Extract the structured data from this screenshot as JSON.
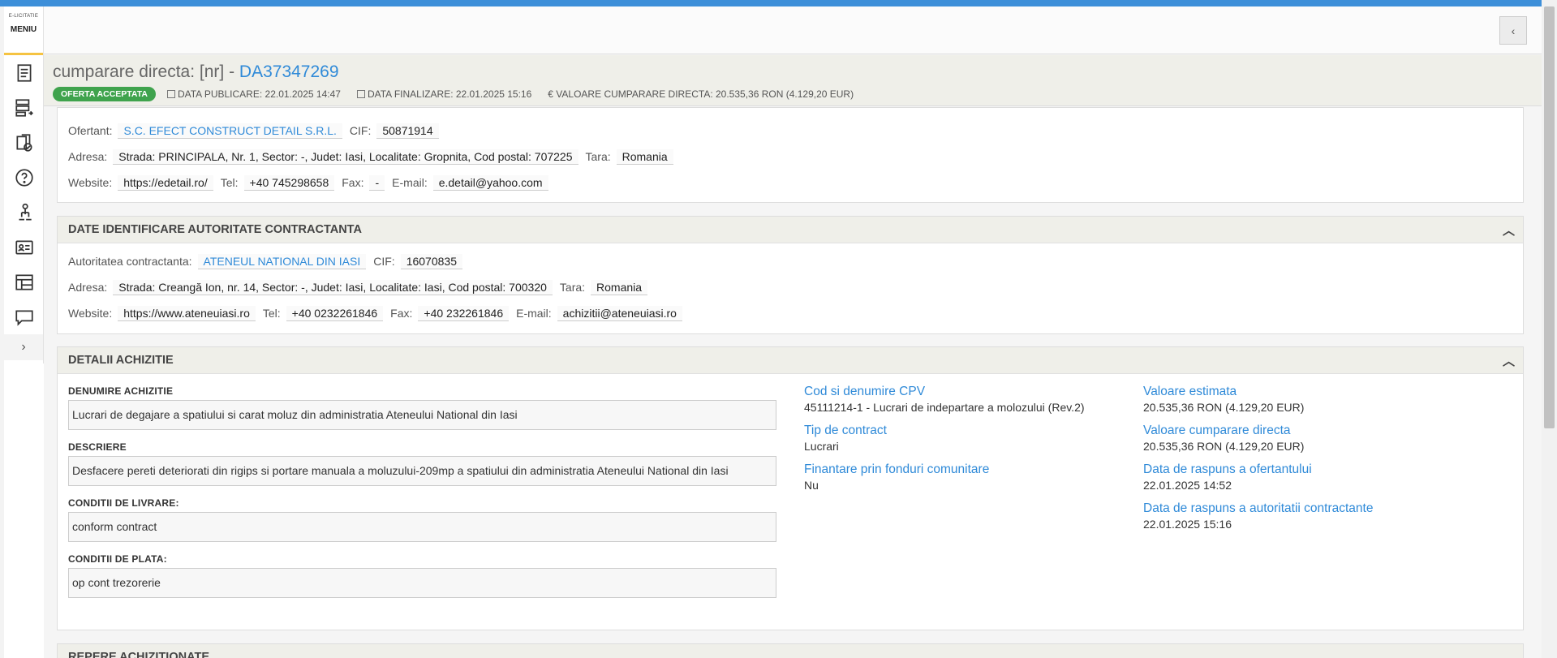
{
  "sidebar": {
    "logo_small": "E-LICITATIE",
    "menu_label": "MENIU",
    "expand_glyph": "›",
    "icons": [
      "document-icon",
      "list-export-icon",
      "clipboard-check-icon",
      "help-circle-icon",
      "user-tree-icon",
      "id-card-icon",
      "layout-icon",
      "chat-bubble-icon"
    ]
  },
  "header": {
    "collapse_glyph": "‹"
  },
  "procedure": {
    "title_prefix": "cumparare directa: [nr] - ",
    "code": "DA37347269",
    "status_badge": "OFERTA ACCEPTATA",
    "publish": "DATA PUBLICARE: 22.01.2025 14:47",
    "finish": "DATA FINALIZARE: 22.01.2025 15:16",
    "value": "€ VALOARE CUMPARARE DIRECTA: 20.535,36  RON (4.129,20  EUR)"
  },
  "ofertant": {
    "label_name": "Ofertant:",
    "name": "S.C. EFECT CONSTRUCT DETAIL S.R.L.",
    "label_cif": "CIF:",
    "cif": "50871914",
    "label_address": "Adresa:",
    "address": "Strada: PRINCIPALA, Nr. 1, Sector: -, Judet: Iasi, Localitate: Gropnita, Cod postal: 707225",
    "label_country": "Tara:",
    "country": "Romania",
    "label_website": "Website:",
    "website": "https://edetail.ro/",
    "label_tel": "Tel:",
    "tel": "+40 745298658",
    "label_fax": "Fax:",
    "fax": "-",
    "label_email": "E-mail:",
    "email": "e.detail@yahoo.com"
  },
  "authority": {
    "heading": "DATE IDENTIFICARE AUTORITATE CONTRACTANTA",
    "label_name": "Autoritatea contractanta:",
    "name": "ATENEUL NATIONAL DIN IASI",
    "label_cif": "CIF:",
    "cif": "16070835",
    "label_address": "Adresa:",
    "address": "Strada: Creangă Ion, nr. 14, Sector: -, Judet: Iasi, Localitate: Iasi, Cod postal: 700320",
    "label_country": "Tara:",
    "country": "Romania",
    "label_website": "Website:",
    "website": "https://www.ateneuiasi.ro",
    "label_tel": "Tel:",
    "tel": "+40 0232261846",
    "label_fax": "Fax:",
    "fax": "+40 232261846",
    "label_email": "E-mail:",
    "email": "achizitii@ateneuiasi.ro"
  },
  "details": {
    "heading": "DETALII ACHIZITIE",
    "name_label": "DENUMIRE ACHIZITIE",
    "name": "Lucrari de degajare a spatiului si carat moluz din administratia Ateneului National din Iasi",
    "desc_label": "DESCRIERE",
    "desc": "Desfacere pereti deteriorati din rigips si portare manuala a moluzului-209mp a spatiului din administratia Ateneului National din Iasi",
    "delivery_label": "CONDITII DE LIVRARE:",
    "delivery": "conform contract",
    "payment_label": "CONDITII DE PLATA:",
    "payment": "op cont trezorerie",
    "cpv_label": "Cod si denumire CPV",
    "cpv": "45111214-1 - Lucrari de indepartare a molozului (Rev.2)",
    "contract_type_label": "Tip de contract",
    "contract_type": "Lucrari",
    "eu_funds_label": "Finantare prin fonduri comunitare",
    "eu_funds": "Nu",
    "est_value_label": "Valoare estimata",
    "est_value": "20.535,36  RON (4.129,20  EUR)",
    "direct_value_label": "Valoare cumparare directa",
    "direct_value": "20.535,36  RON (4.129,20  EUR)",
    "bidder_answer_label": "Data de raspuns a ofertantului",
    "bidder_answer": "22.01.2025 14:52",
    "authority_answer_label": "Data de raspuns a autoritatii contractante",
    "authority_answer": "22.01.2025 15:16"
  },
  "next_section": {
    "heading": "REPERE ACHIZITIONATE"
  }
}
